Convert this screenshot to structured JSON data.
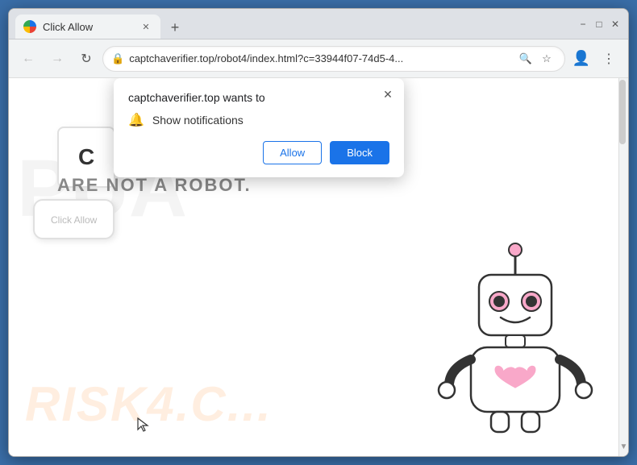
{
  "window": {
    "title": "Click Allow",
    "favicon": "globe-icon"
  },
  "titlebar": {
    "minimize_label": "−",
    "maximize_label": "□",
    "close_label": "✕",
    "new_tab_label": "+"
  },
  "navbar": {
    "back_label": "←",
    "forward_label": "→",
    "reload_label": "↻",
    "url": "captchaverifier.top/robot4/index.html?c=33944f07-74d5-4...",
    "url_domain": "captchaverifier.top",
    "url_path": "/robot4/index.html?c=33944f07-74d5-4..."
  },
  "dialog": {
    "title": "captchaverifier.top wants to",
    "permission_label": "Show notifications",
    "close_label": "✕",
    "allow_label": "Allow",
    "block_label": "Block"
  },
  "webpage": {
    "heading_partial": "C",
    "subtext": "ARE NOT A ROBOT.",
    "watermark": "RISK4.C...",
    "watermark2": "PUA"
  }
}
